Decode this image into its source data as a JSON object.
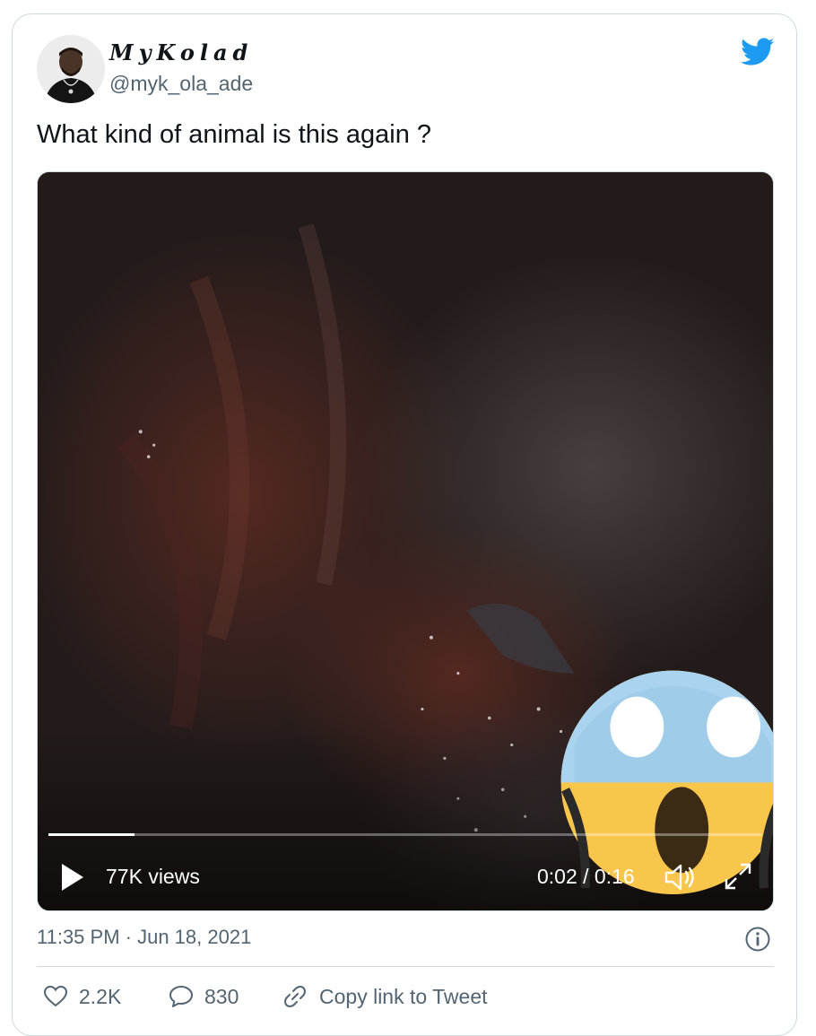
{
  "author": {
    "display_name": "MyKolad",
    "handle": "@myk_ola_ade"
  },
  "tweet": {
    "text": "What kind of animal is this again ?",
    "timestamp": "11:35 PM · Jun 18, 2021"
  },
  "video": {
    "views": "77K views",
    "time": "0:02 / 0:16",
    "progress_fraction": 0.12
  },
  "actions": {
    "likes": "2.2K",
    "replies": "830",
    "copy_link": "Copy link to Tweet"
  },
  "colors": {
    "twitter_blue": "#1d9bf0",
    "text_primary": "#0f1419",
    "text_secondary": "#536471",
    "border": "#cfd9de"
  },
  "icons": {
    "brand": "twitter-bird-icon",
    "play": "play-icon",
    "volume": "volume-icon",
    "fullscreen": "fullscreen-icon",
    "info": "info-icon",
    "like": "heart-icon",
    "reply": "reply-bubble-icon",
    "link": "link-icon"
  }
}
